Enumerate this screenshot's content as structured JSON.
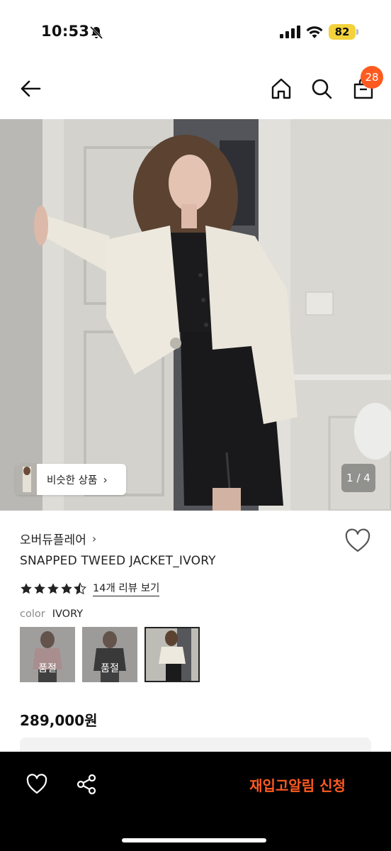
{
  "status_bar": {
    "time": "10:53",
    "battery": "82",
    "icons": [
      "bell-off-icon",
      "signal-icon",
      "wifi-icon",
      "battery-icon"
    ]
  },
  "nav": {
    "icons": [
      "back-arrow-icon",
      "home-icon",
      "search-icon",
      "shopping-bag-icon"
    ],
    "cart_count": "28"
  },
  "hero": {
    "similar_label": "비슷한 상품",
    "similar_chevron": "›",
    "pager": "1 / 4"
  },
  "product": {
    "brand": "오버듀플레어",
    "brand_chevron": "›",
    "name": "SNAPPED TWEED JACKET_IVORY",
    "rating": 4.5,
    "review_link": "14개 리뷰 보기",
    "color_label": "color",
    "color_value": "IVORY",
    "swatches": [
      {
        "name": "pink",
        "status": "품절"
      },
      {
        "name": "black",
        "status": "품절"
      },
      {
        "name": "ivory",
        "status": ""
      }
    ],
    "price": "289,000원"
  },
  "bottom_bar": {
    "icons": [
      "heart-icon",
      "share-icon"
    ],
    "restock_button": "재입고알림 신청"
  },
  "colors": {
    "accent": "#ff5a1f",
    "battery": "#f3d23c",
    "bottom_bar": "#000000"
  }
}
